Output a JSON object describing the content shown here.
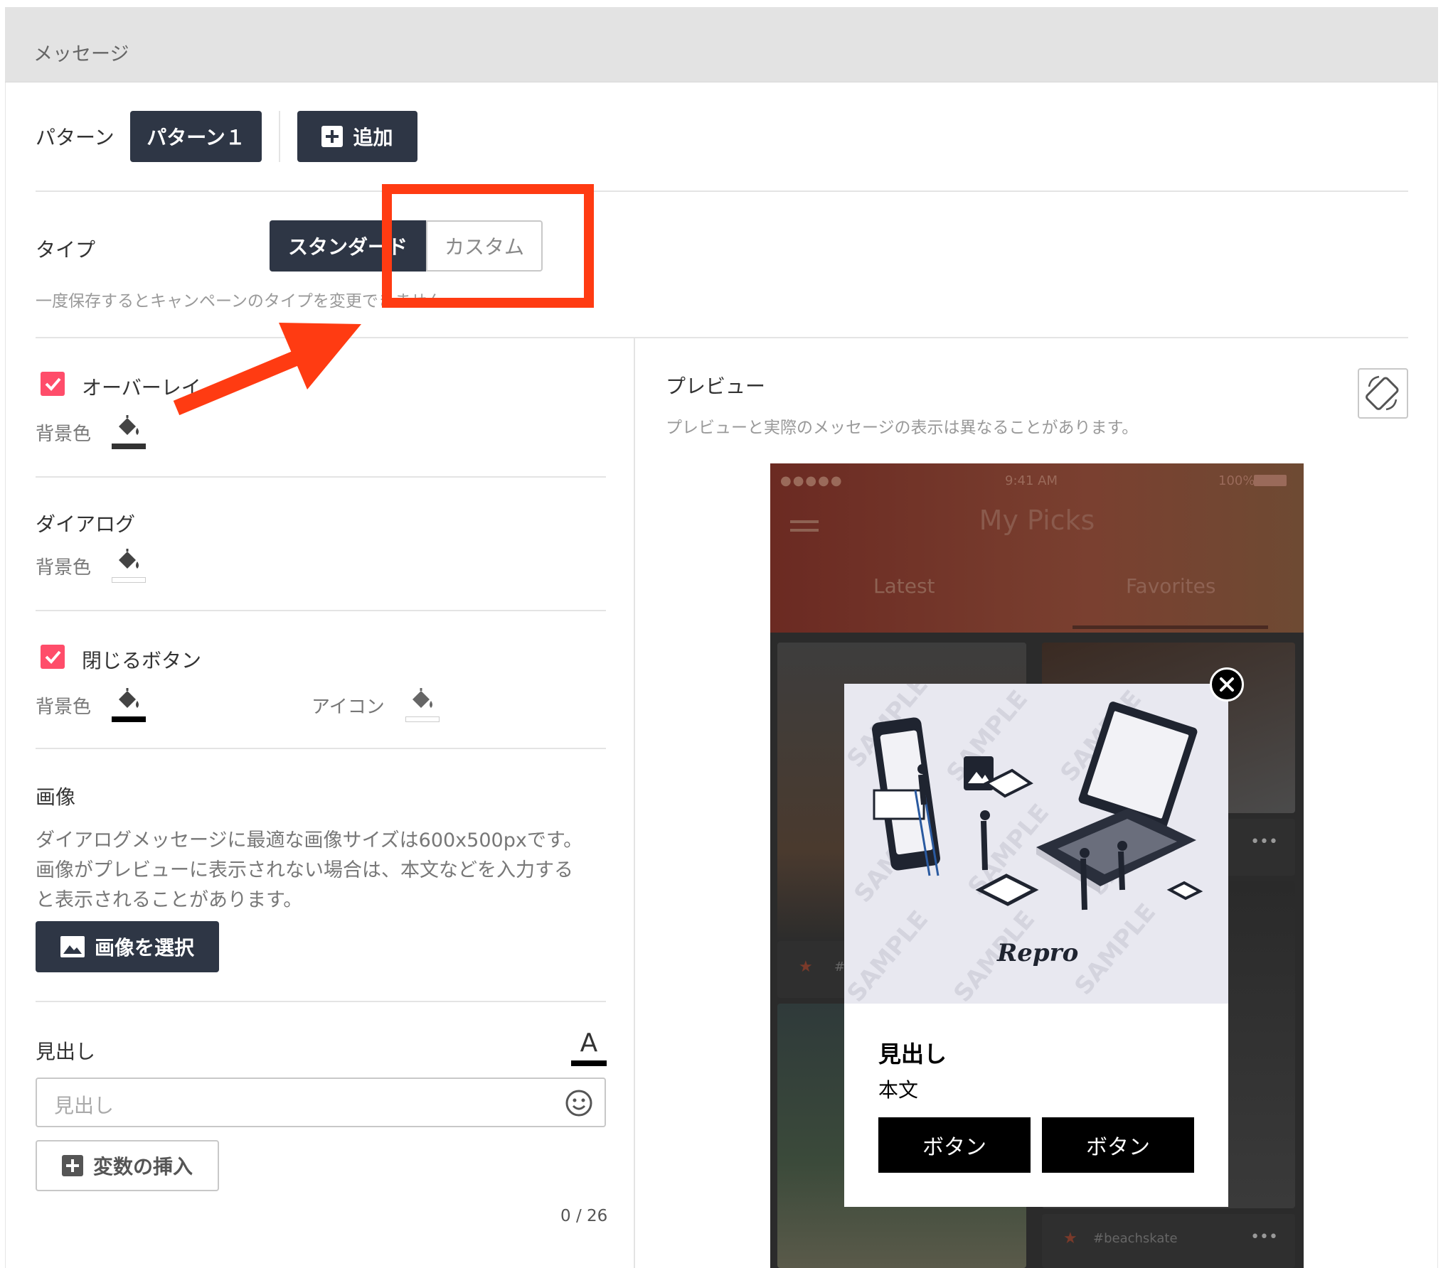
{
  "header": {
    "title": "メッセージ"
  },
  "pattern": {
    "label": "パターン",
    "active": "パターン１",
    "add": "追加"
  },
  "type": {
    "label": "タイプ",
    "options": [
      "スタンダード",
      "カスタム"
    ],
    "selected": "スタンダード",
    "help": "一度保存するとキャンペーンのタイプを変更できません"
  },
  "overlay": {
    "label": "オーバーレイ",
    "checked": true,
    "bg_label": "背景色"
  },
  "dialog": {
    "label": "ダイアログ",
    "bg_label": "背景色"
  },
  "close_button": {
    "label": "閉じるボタン",
    "checked": true,
    "bg_label": "背景色",
    "icon_label": "アイコン"
  },
  "image": {
    "label": "画像",
    "desc_line1": "ダイアログメッセージに最適な画像サイズは600x500pxです。",
    "desc_line2": "画像がプレビューに表示されない場合は、本文などを入力する",
    "desc_line3": "と表示されることがあります。",
    "select_button": "画像を選択"
  },
  "headline": {
    "label": "見出し",
    "font_icon_text": "A",
    "placeholder": "見出し",
    "insert_variable": "変数の挿入",
    "counter": "0 / 26"
  },
  "preview": {
    "title": "プレビュー",
    "note": "プレビューと実際のメッセージの表示は異なることがあります。",
    "phone": {
      "time": "9:41 AM",
      "battery": "100%",
      "app_title": "My Picks",
      "tabs": [
        "Latest",
        "Favorites"
      ],
      "tag1": "#s",
      "tag2": "#beachskate"
    },
    "dialog": {
      "watermark": "SAMPLE",
      "brand": "Repro",
      "headline": "見出し",
      "body": "本文",
      "buttons": [
        "ボタン",
        "ボタン"
      ]
    }
  },
  "colors": {
    "dark": "#2e3645",
    "accent": "#ff4d6a",
    "annotation": "#ff3b12"
  }
}
